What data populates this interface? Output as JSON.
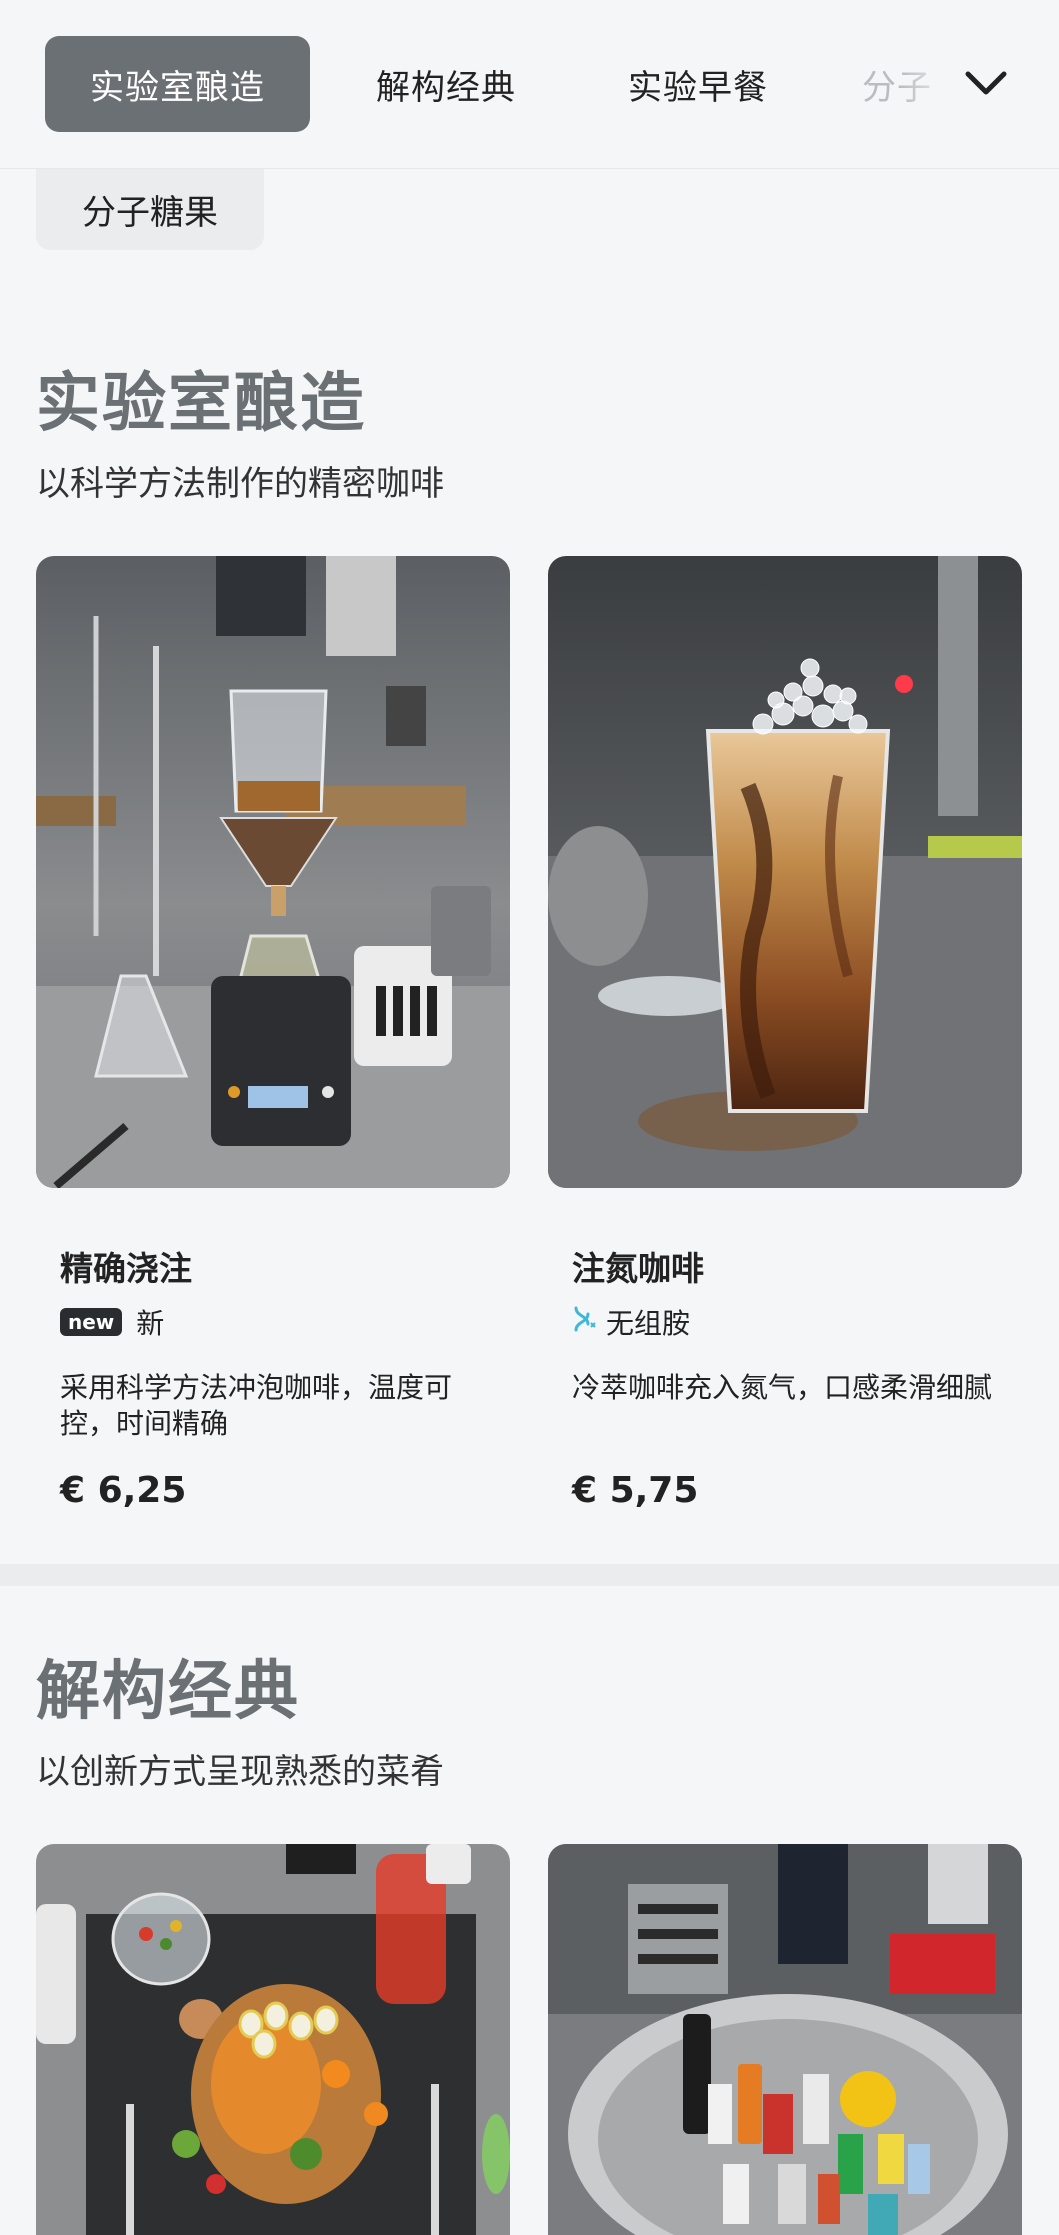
{
  "tabs": [
    {
      "label": "实验室酿造",
      "active": true
    },
    {
      "label": "解构经典",
      "active": false
    },
    {
      "label": "实验早餐",
      "active": false
    },
    {
      "label": "分子",
      "active": false
    }
  ],
  "chip": {
    "label": "分子糖果"
  },
  "sections": [
    {
      "title": "实验室酿造",
      "subtitle": "以科学方法制作的精密咖啡",
      "items": [
        {
          "name": "精确浇注",
          "badge": "new",
          "tag": "新",
          "description": "采用科学方法冲泡咖啡，温度可控，时间精确",
          "price": "€ 6,25"
        },
        {
          "name": "注氮咖啡",
          "tag_icon": "dna-icon",
          "tag": "无组胺",
          "description": "冷萃咖啡充入氮气，口感柔滑细腻",
          "price": "€ 5,75"
        }
      ]
    },
    {
      "title": "解构经典",
      "subtitle": "以创新方式呈现熟悉的菜肴",
      "items": [
        {},
        {}
      ]
    }
  ],
  "icons": {
    "dropdown": "chevron-down-icon",
    "dna": "dna-icon"
  },
  "colors": {
    "active_tab_bg": "#6b7075",
    "section_title": "#6b7075",
    "dna_icon": "#3fb8d6"
  }
}
